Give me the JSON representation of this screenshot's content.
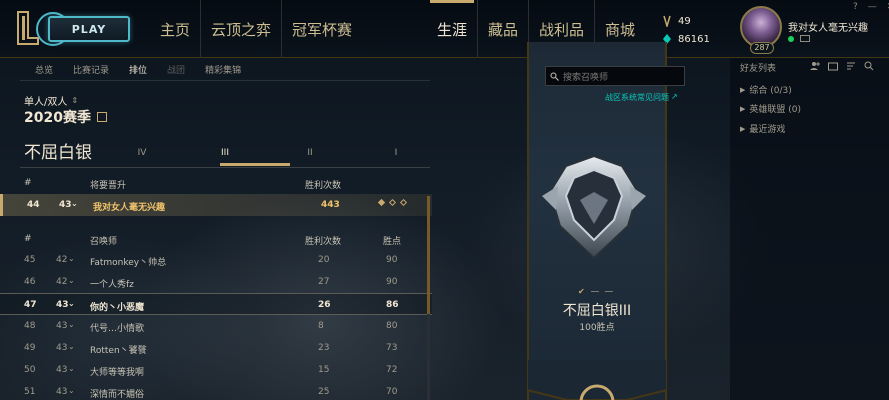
{
  "topbar": {
    "play_label": "PLAY",
    "nav_left": [
      "主页",
      "云顶之弈",
      "冠军杯赛"
    ],
    "nav_right": [
      "生涯",
      "藏品",
      "战利品",
      "商城"
    ],
    "active_nav": "生涯",
    "currency": {
      "be": "49",
      "rp": "86161"
    },
    "profile": {
      "name": "我对女人毫无兴趣",
      "level": "287",
      "status_color": "#1fcf5a"
    },
    "window_controls": [
      "?",
      "—",
      "✕"
    ]
  },
  "subnav": {
    "items": [
      {
        "label": "总览",
        "state": "normal"
      },
      {
        "label": "比赛记录",
        "state": "normal"
      },
      {
        "label": "排位",
        "state": "active"
      },
      {
        "label": "战团",
        "state": "dim"
      },
      {
        "label": "精彩集锦",
        "state": "normal"
      }
    ]
  },
  "ranked": {
    "queue": "单人/双人",
    "season": "2020赛季",
    "tier_title": "不屈白银",
    "divisions": [
      "IV",
      "III",
      "II",
      "I"
    ],
    "active_division": "III"
  },
  "promotion_table": {
    "headers": {
      "rank": "#",
      "name": "将要晋升",
      "wins": "胜利次数"
    },
    "row": {
      "rank": "44",
      "lp": "43",
      "name": "我对女人毫无兴趣",
      "wins": "443",
      "series": [
        "won",
        "pending",
        "pending"
      ]
    }
  },
  "ladder_table": {
    "headers": {
      "rank": "#",
      "name": "召唤师",
      "wins": "胜利次数",
      "points": "胜点"
    },
    "rows": [
      {
        "rank": "45",
        "lp": "42",
        "name": "Fatmonkey丶帅总",
        "wins": "20",
        "points": "90",
        "self": false
      },
      {
        "rank": "46",
        "lp": "42",
        "name": "一个人秀fz",
        "wins": "27",
        "points": "90",
        "self": false
      },
      {
        "rank": "47",
        "lp": "43",
        "name": "你的丶小恶魔",
        "wins": "26",
        "points": "86",
        "self": true
      },
      {
        "rank": "48",
        "lp": "43",
        "name": "代号…小情歌",
        "wins": "8",
        "points": "80",
        "self": false
      },
      {
        "rank": "49",
        "lp": "43",
        "name": "Rotten丶饕餮",
        "wins": "23",
        "points": "73",
        "self": false
      },
      {
        "rank": "50",
        "lp": "43",
        "name": "大师等等我啊",
        "wins": "15",
        "points": "72",
        "self": false
      },
      {
        "rank": "51",
        "lp": "43",
        "name": "深情而不媚俗",
        "wins": "25",
        "points": "70",
        "self": false
      }
    ],
    "scroll_fraction": 0.58
  },
  "banner": {
    "search_placeholder": "搜索召唤师",
    "server_link": "战区系统常见问题",
    "rank_name": "不屈白银III",
    "rank_points": "100胜点",
    "accent": "#c8aa6e"
  },
  "friends": {
    "title": "好友列表",
    "groups": [
      "综合 (0/3)",
      "英雄联盟 (0)",
      "最近游戏"
    ]
  }
}
